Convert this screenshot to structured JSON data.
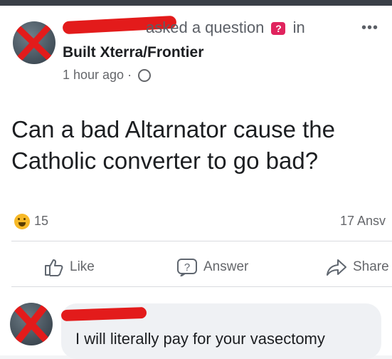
{
  "post": {
    "author_action": "asked a question",
    "in_word": "in",
    "group_name": "Built Xterra/Frontier",
    "timestamp": "1 hour ago",
    "separator": "·",
    "more_label": "•••",
    "question": "Can a bad Altarnator cause the Catholic converter to go bad?"
  },
  "stats": {
    "reaction_count": "15",
    "answers_count": "17 Ansv"
  },
  "actions": {
    "like": "Like",
    "answer": "Answer",
    "share": "Share"
  },
  "comment": {
    "text": "I will literally pay for your vasectomy"
  },
  "colors": {
    "redaction": "#e31b1b",
    "question_badge": "#e0245e",
    "reaction_emoji": "#f7b928"
  }
}
